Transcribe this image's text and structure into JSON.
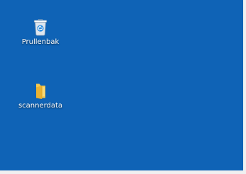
{
  "desktop": {
    "background_color": "#0f63b6",
    "icons": [
      {
        "label": "Prullenbak",
        "icon": "recycle-bin-icon"
      },
      {
        "label": "scannerdata",
        "icon": "folder-icon"
      }
    ]
  }
}
